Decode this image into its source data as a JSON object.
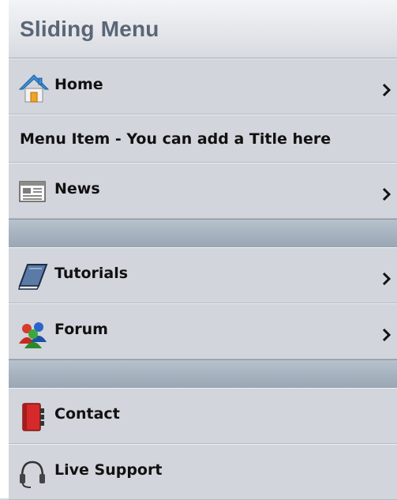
{
  "header": {
    "title": "Sliding Menu"
  },
  "menu": {
    "home": "Home",
    "title_item": "Menu Item - You can add a Title here",
    "news": "News",
    "tutorials": "Tutorials",
    "forum": "Forum",
    "contact": "Contact",
    "live_support": "Live Support"
  },
  "colors": {
    "header_text": "#5a6676",
    "item_background": "#d2d5db",
    "divider": "#a6b2bf"
  }
}
